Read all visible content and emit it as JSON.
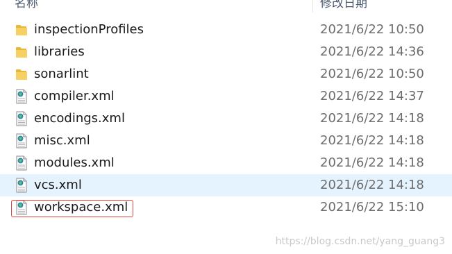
{
  "header": {
    "name_label": "名称",
    "date_label": "修改日期"
  },
  "files": [
    {
      "name": "inspectionProfiles",
      "modified": "2021/6/22 10:50",
      "type": "folder",
      "icon": "folder-icon"
    },
    {
      "name": "libraries",
      "modified": "2021/6/22 14:36",
      "type": "folder",
      "icon": "folder-icon"
    },
    {
      "name": "sonarlint",
      "modified": "2021/6/22 10:50",
      "type": "folder",
      "icon": "folder-icon"
    },
    {
      "name": "compiler.xml",
      "modified": "2021/6/22 14:37",
      "type": "xml",
      "icon": "xml-file-icon"
    },
    {
      "name": "encodings.xml",
      "modified": "2021/6/22 14:18",
      "type": "xml",
      "icon": "xml-file-icon"
    },
    {
      "name": "misc.xml",
      "modified": "2021/6/22 14:18",
      "type": "xml",
      "icon": "xml-file-icon"
    },
    {
      "name": "modules.xml",
      "modified": "2021/6/22 14:18",
      "type": "xml",
      "icon": "xml-file-icon"
    },
    {
      "name": "vcs.xml",
      "modified": "2021/6/22 14:18",
      "type": "xml",
      "icon": "xml-file-icon",
      "hovered": true
    },
    {
      "name": "workspace.xml",
      "modified": "2021/6/22 15:10",
      "type": "xml",
      "icon": "xml-file-icon",
      "highlighted": true
    }
  ],
  "watermark": "https://blog.csdn.net/yang_guang3",
  "colors": {
    "hover_bg": "#e5f3ff",
    "highlight_border": "#e8413c",
    "folder": "#f5c84c",
    "date_text": "#6d6d6d"
  }
}
